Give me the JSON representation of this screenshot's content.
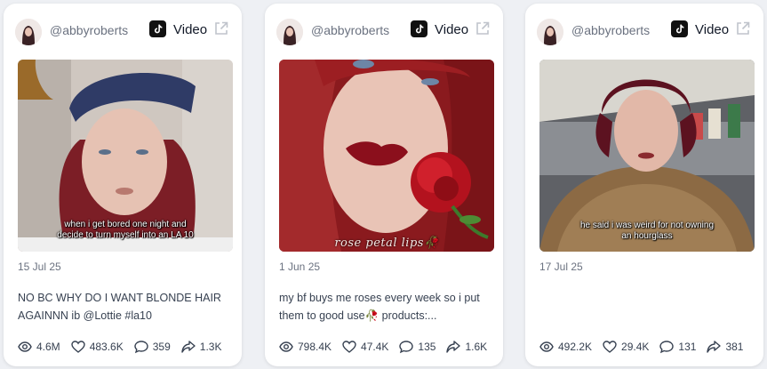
{
  "cards": [
    {
      "handle": "@abbyroberts",
      "platform": "Video",
      "platform_icon": "tiktok-icon",
      "overlay_text": "when i get bored one night and decide to turn myself into an LA 10",
      "date": "15 Jul 25",
      "description": "NO BC WHY DO I WANT BLONDE HAIR AGAINNN ib @Lottie #la10",
      "stats": {
        "views": "4.6M",
        "likes": "483.6K",
        "comments": "359",
        "shares": "1.3K"
      }
    },
    {
      "handle": "@abbyroberts",
      "platform": "Video",
      "platform_icon": "tiktok-icon",
      "overlay_text": "rose petal lips🥀",
      "date": "1 Jun 25",
      "description": "my bf buys me roses every week so i put them to good use🥀 products:...",
      "stats": {
        "views": "798.4K",
        "likes": "47.4K",
        "comments": "135",
        "shares": "1.6K"
      }
    },
    {
      "handle": "@abbyroberts",
      "platform": "Video",
      "platform_icon": "tiktok-icon",
      "overlay_text": "he said i was weird for not owning an hourglass",
      "date": "17 Jul 25",
      "description": "",
      "stats": {
        "views": "492.2K",
        "likes": "29.4K",
        "comments": "131",
        "shares": "381"
      }
    }
  ],
  "colors": {
    "card_bg": "#ffffff",
    "page_bg": "#eef0f4",
    "muted_text": "#6b7280"
  }
}
